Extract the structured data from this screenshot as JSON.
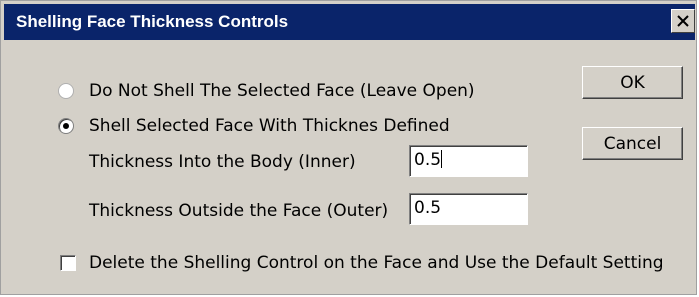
{
  "dialog": {
    "title": "Shelling Face Thickness Controls",
    "close_glyph": "✕"
  },
  "options": {
    "do_not_shell_label": "Do Not Shell The Selected Face (Leave Open)",
    "shell_with_thickness_label": "Shell Selected Face With Thicknes Defined",
    "selected": "shell_with_thickness"
  },
  "thickness": {
    "inner_label": "Thickness Into the Body (Inner)",
    "inner_value": "0.5",
    "outer_label": "Thickness Outside the Face (Outer)",
    "outer_value": "0.5"
  },
  "delete_control": {
    "label": "Delete the Shelling Control on the Face and Use the Default Setting",
    "checked": false
  },
  "buttons": {
    "ok_label": "OK",
    "cancel_label": "Cancel"
  },
  "colors": {
    "titlebar": "#0a246a",
    "dialog_bg": "#d4d0c8"
  }
}
